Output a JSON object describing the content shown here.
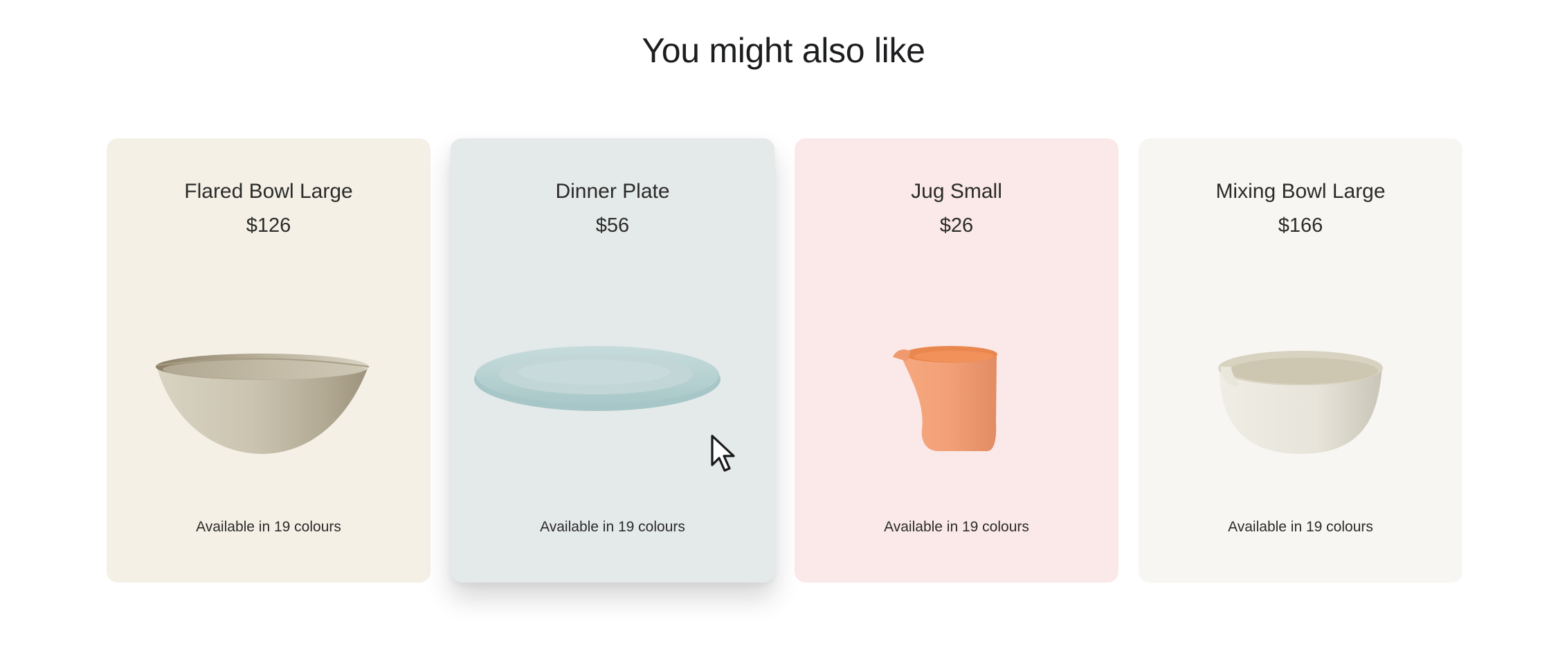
{
  "section": {
    "title": "You might also like"
  },
  "products": [
    {
      "name": "Flared Bowl Large",
      "price": "$126",
      "availability": "Available in 19 colours",
      "card_color": "#f4f0e6",
      "image_icon": "flared-bowl-image"
    },
    {
      "name": "Dinner Plate",
      "price": "$56",
      "availability": "Available in 19 colours",
      "card_color": "#e4e9e9",
      "image_icon": "dinner-plate-image"
    },
    {
      "name": "Jug Small",
      "price": "$26",
      "availability": "Available in 19 colours",
      "card_color": "#fae9e8",
      "image_icon": "jug-image"
    },
    {
      "name": "Mixing Bowl Large",
      "price": "$166",
      "availability": "Available in 19 colours",
      "card_color": "#f7f6f2",
      "image_icon": "mixing-bowl-image"
    }
  ],
  "pointer": {
    "icon": "mouse-pointer-icon"
  }
}
